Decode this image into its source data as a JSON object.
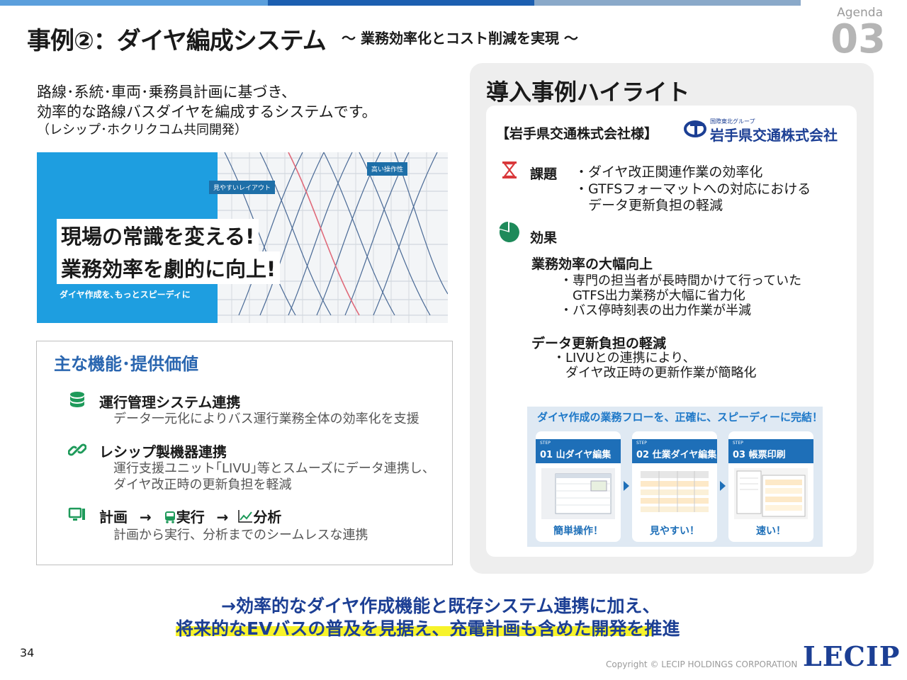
{
  "header": {
    "title": "事例②：ダイヤ編成システム",
    "subtitle": "～ 業務効率化とコスト削減を実現 ～",
    "agenda_label": "Agenda",
    "agenda_number": "03",
    "bar_colors": [
      "#3b8ed6",
      "#1c5fb0",
      "#7ea7cf"
    ]
  },
  "intro": {
    "line1": "路線･系統･車両･乗務員計画に基づき、",
    "line2": "効率的な路線バスダイヤを編成するシステムです。",
    "line3": "（レシップ･ホクリクコム共同開発）"
  },
  "hero": {
    "headline1": "現場の常識を変える!",
    "headline2": "業務効率を劇的に向上!",
    "tagline": "ダイヤ作成を､もっとスピーディに",
    "bubble1": "高い操作性",
    "bubble2": "見やすいレイアウト"
  },
  "features": {
    "heading": "主な機能･提供価値",
    "items": [
      {
        "icon": "database-icon",
        "title": "運行管理システム連携",
        "desc1": "データ一元化によりバス運行業務全体の効率化を支援",
        "desc2": ""
      },
      {
        "icon": "link-icon",
        "title": "レシップ製機器連携",
        "desc1": "運行支援ユニット｢LIVU｣等とスムーズにデータ連携し、",
        "desc2": "ダイヤ改正時の更新負担を軽減"
      },
      {
        "icon": "monitor-icon",
        "title_plan": "計画",
        "title_run": "実行",
        "title_analyze": "分析",
        "arrow": "→",
        "desc1": "計画から実行、分析までのシームレスな連携",
        "desc2": ""
      }
    ]
  },
  "highlight": {
    "heading": "導入事例ハイライト",
    "client": "【岩手県交通株式会社様】",
    "logo_small": "国際東北グループ",
    "logo_big": "岩手県交通株式会社",
    "issue_label": "課題",
    "issue_lines": [
      "・ダイヤ改正関連作業の効率化",
      "・GTFSフォーマットへの対応における",
      "　データ更新負担の軽減"
    ],
    "effect_label": "効果",
    "effect1_title": "業務効率の大幅向上",
    "effect1_lines": [
      "・専門の担当者が長時間かけて行っていた",
      "　GTFS出力業務が大幅に省力化",
      "・バス停時刻表の出力作業が半減"
    ],
    "effect2_title": "データ更新負担の軽減",
    "effect2_lines": [
      "・LIVUとの連携により、",
      "　ダイヤ改正時の更新作業が簡略化"
    ],
    "flow": {
      "heading": "ダイヤ作成の業務フローを、正確に、スピーディーに完結！",
      "steps": [
        {
          "tag": "STEP",
          "name": "01 山ダイヤ編集",
          "foot": "簡単操作！"
        },
        {
          "tag": "STEP",
          "name": "02 仕業ダイヤ編集",
          "foot": "見やすい！"
        },
        {
          "tag": "STEP",
          "name": "03 帳票印刷",
          "foot": "速い！"
        }
      ]
    }
  },
  "conclusion": {
    "line1": "→効率的なダイヤ作成機能と既存システム連携に加え、",
    "line2": "将来的なEVバスの普及を見据え、充電計画も含めた開発を推進"
  },
  "footer": {
    "page": "34",
    "copyright": "Copyright © LECIP  HOLDINGS CORPORATION",
    "brand": "LECIP"
  }
}
